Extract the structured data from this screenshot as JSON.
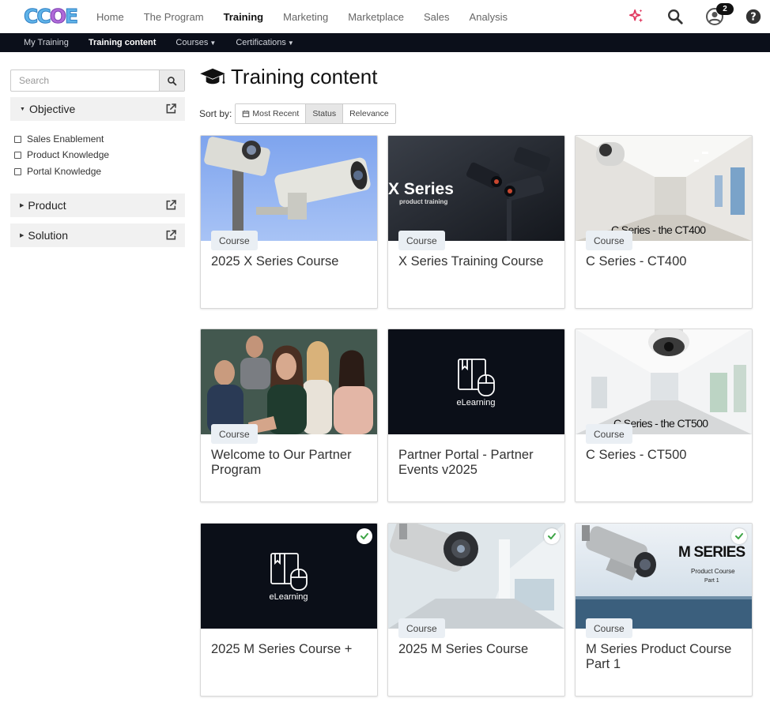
{
  "brand": {
    "logo_text_1": "CC",
    "logo_text_2": "O",
    "logo_text_3": "E"
  },
  "main_nav": [
    {
      "label": "Home"
    },
    {
      "label": "The Program"
    },
    {
      "label": "Training",
      "active": true
    },
    {
      "label": "Marketing"
    },
    {
      "label": "Marketplace"
    },
    {
      "label": "Sales"
    },
    {
      "label": "Analysis"
    }
  ],
  "header_icons": {
    "sparkle": "sparkle-icon",
    "search": "search-icon",
    "profile": "user-circle-icon",
    "help": "help-icon",
    "notification_count": "2",
    "sparkle_color": "#e0345c"
  },
  "sub_nav": [
    {
      "label": "My Training"
    },
    {
      "label": "Training content",
      "active": true
    },
    {
      "label": "Courses",
      "dropdown": true
    },
    {
      "label": "Certifications",
      "dropdown": true
    }
  ],
  "sidebar": {
    "search": {
      "placeholder": "Search",
      "value": ""
    },
    "facets": [
      {
        "label": "Objective",
        "expanded": true,
        "options": [
          {
            "label": "Sales Enablement",
            "checked": false
          },
          {
            "label": "Product Knowledge",
            "checked": false
          },
          {
            "label": "Portal Knowledge",
            "checked": false
          }
        ]
      },
      {
        "label": "Product",
        "expanded": false
      },
      {
        "label": "Solution",
        "expanded": false
      }
    ]
  },
  "main": {
    "title": "Training content",
    "title_icon": "graduation-cap-icon",
    "sort": {
      "label": "Sort by:",
      "options": [
        {
          "label": "Most Recent",
          "icon": "calendar-icon"
        },
        {
          "label": "Status",
          "active": true
        },
        {
          "label": "Relevance"
        }
      ]
    },
    "cards": [
      {
        "title": "2025 X Series Course",
        "tag": "Course",
        "completed": false,
        "thumb_text": ""
      },
      {
        "title": "X Series Training Course",
        "tag": "Course",
        "completed": false,
        "thumb_text": "X Series",
        "thumb_subtext": "product training"
      },
      {
        "title": "C Series - CT400",
        "tag": "Course",
        "completed": false,
        "thumb_text": "C Series - the CT400"
      },
      {
        "title": "Welcome to Our Partner Program",
        "tag": "Course",
        "completed": false,
        "thumb_text": ""
      },
      {
        "title": "Partner Portal - Partner Events v2025",
        "tag": "",
        "completed": false,
        "thumb_text": "eLearning"
      },
      {
        "title": "C Series - CT500",
        "tag": "Course",
        "completed": false,
        "thumb_text": "C Series - the CT500"
      },
      {
        "title": "2025 M Series Course +",
        "tag": "",
        "completed": true,
        "thumb_text": "eLearning"
      },
      {
        "title": "2025 M Series Course",
        "tag": "Course",
        "completed": true,
        "thumb_text": ""
      },
      {
        "title": "M Series Product Course Part 1",
        "tag": "Course",
        "completed": true,
        "thumb_text": "M SERIES",
        "thumb_subtext": "Product Course",
        "thumb_subtext2": "Part 1"
      }
    ]
  }
}
